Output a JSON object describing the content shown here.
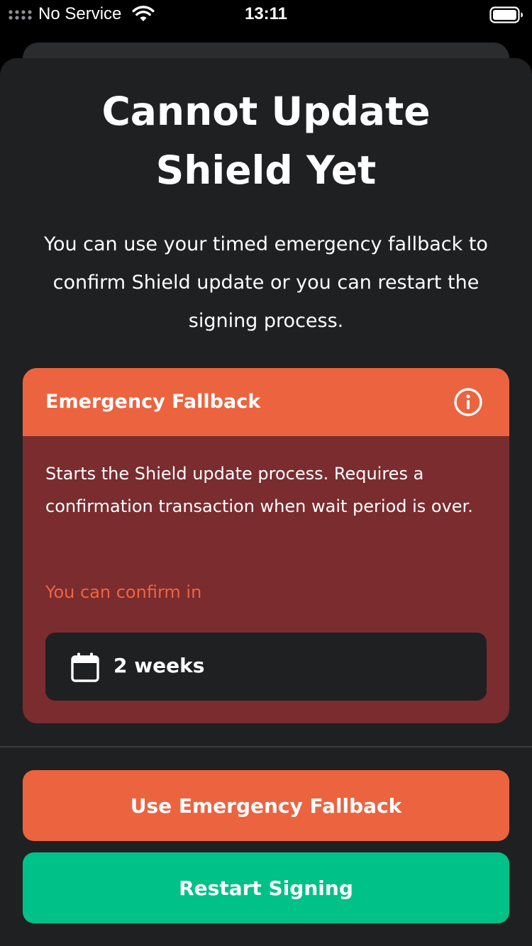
{
  "status_bar": {
    "carrier": "No Service",
    "time": "13:11"
  },
  "sheet": {
    "title": "Cannot Update Shield Yet",
    "subtitle": "You can use your timed emergency fallback to confirm Shield update or you can restart the signing process."
  },
  "emergency_card": {
    "title": "Emergency Fallback",
    "description": "Starts the Shield update process. Requires a confirmation transaction when wait period is over.",
    "confirm_label": "You can confirm in",
    "duration": "2 weeks"
  },
  "actions": {
    "fallback_label": "Use Emergency Fallback",
    "restart_label": "Restart Signing"
  },
  "colors": {
    "accent_orange": "#ec6340",
    "card_red": "#7a2c2f",
    "accent_green": "#00c187",
    "sheet_bg": "#1f2021"
  },
  "icons": {
    "signal": "signal-dots-icon",
    "wifi": "wifi-icon",
    "battery": "battery-icon",
    "info": "info-icon",
    "calendar": "calendar-icon"
  }
}
